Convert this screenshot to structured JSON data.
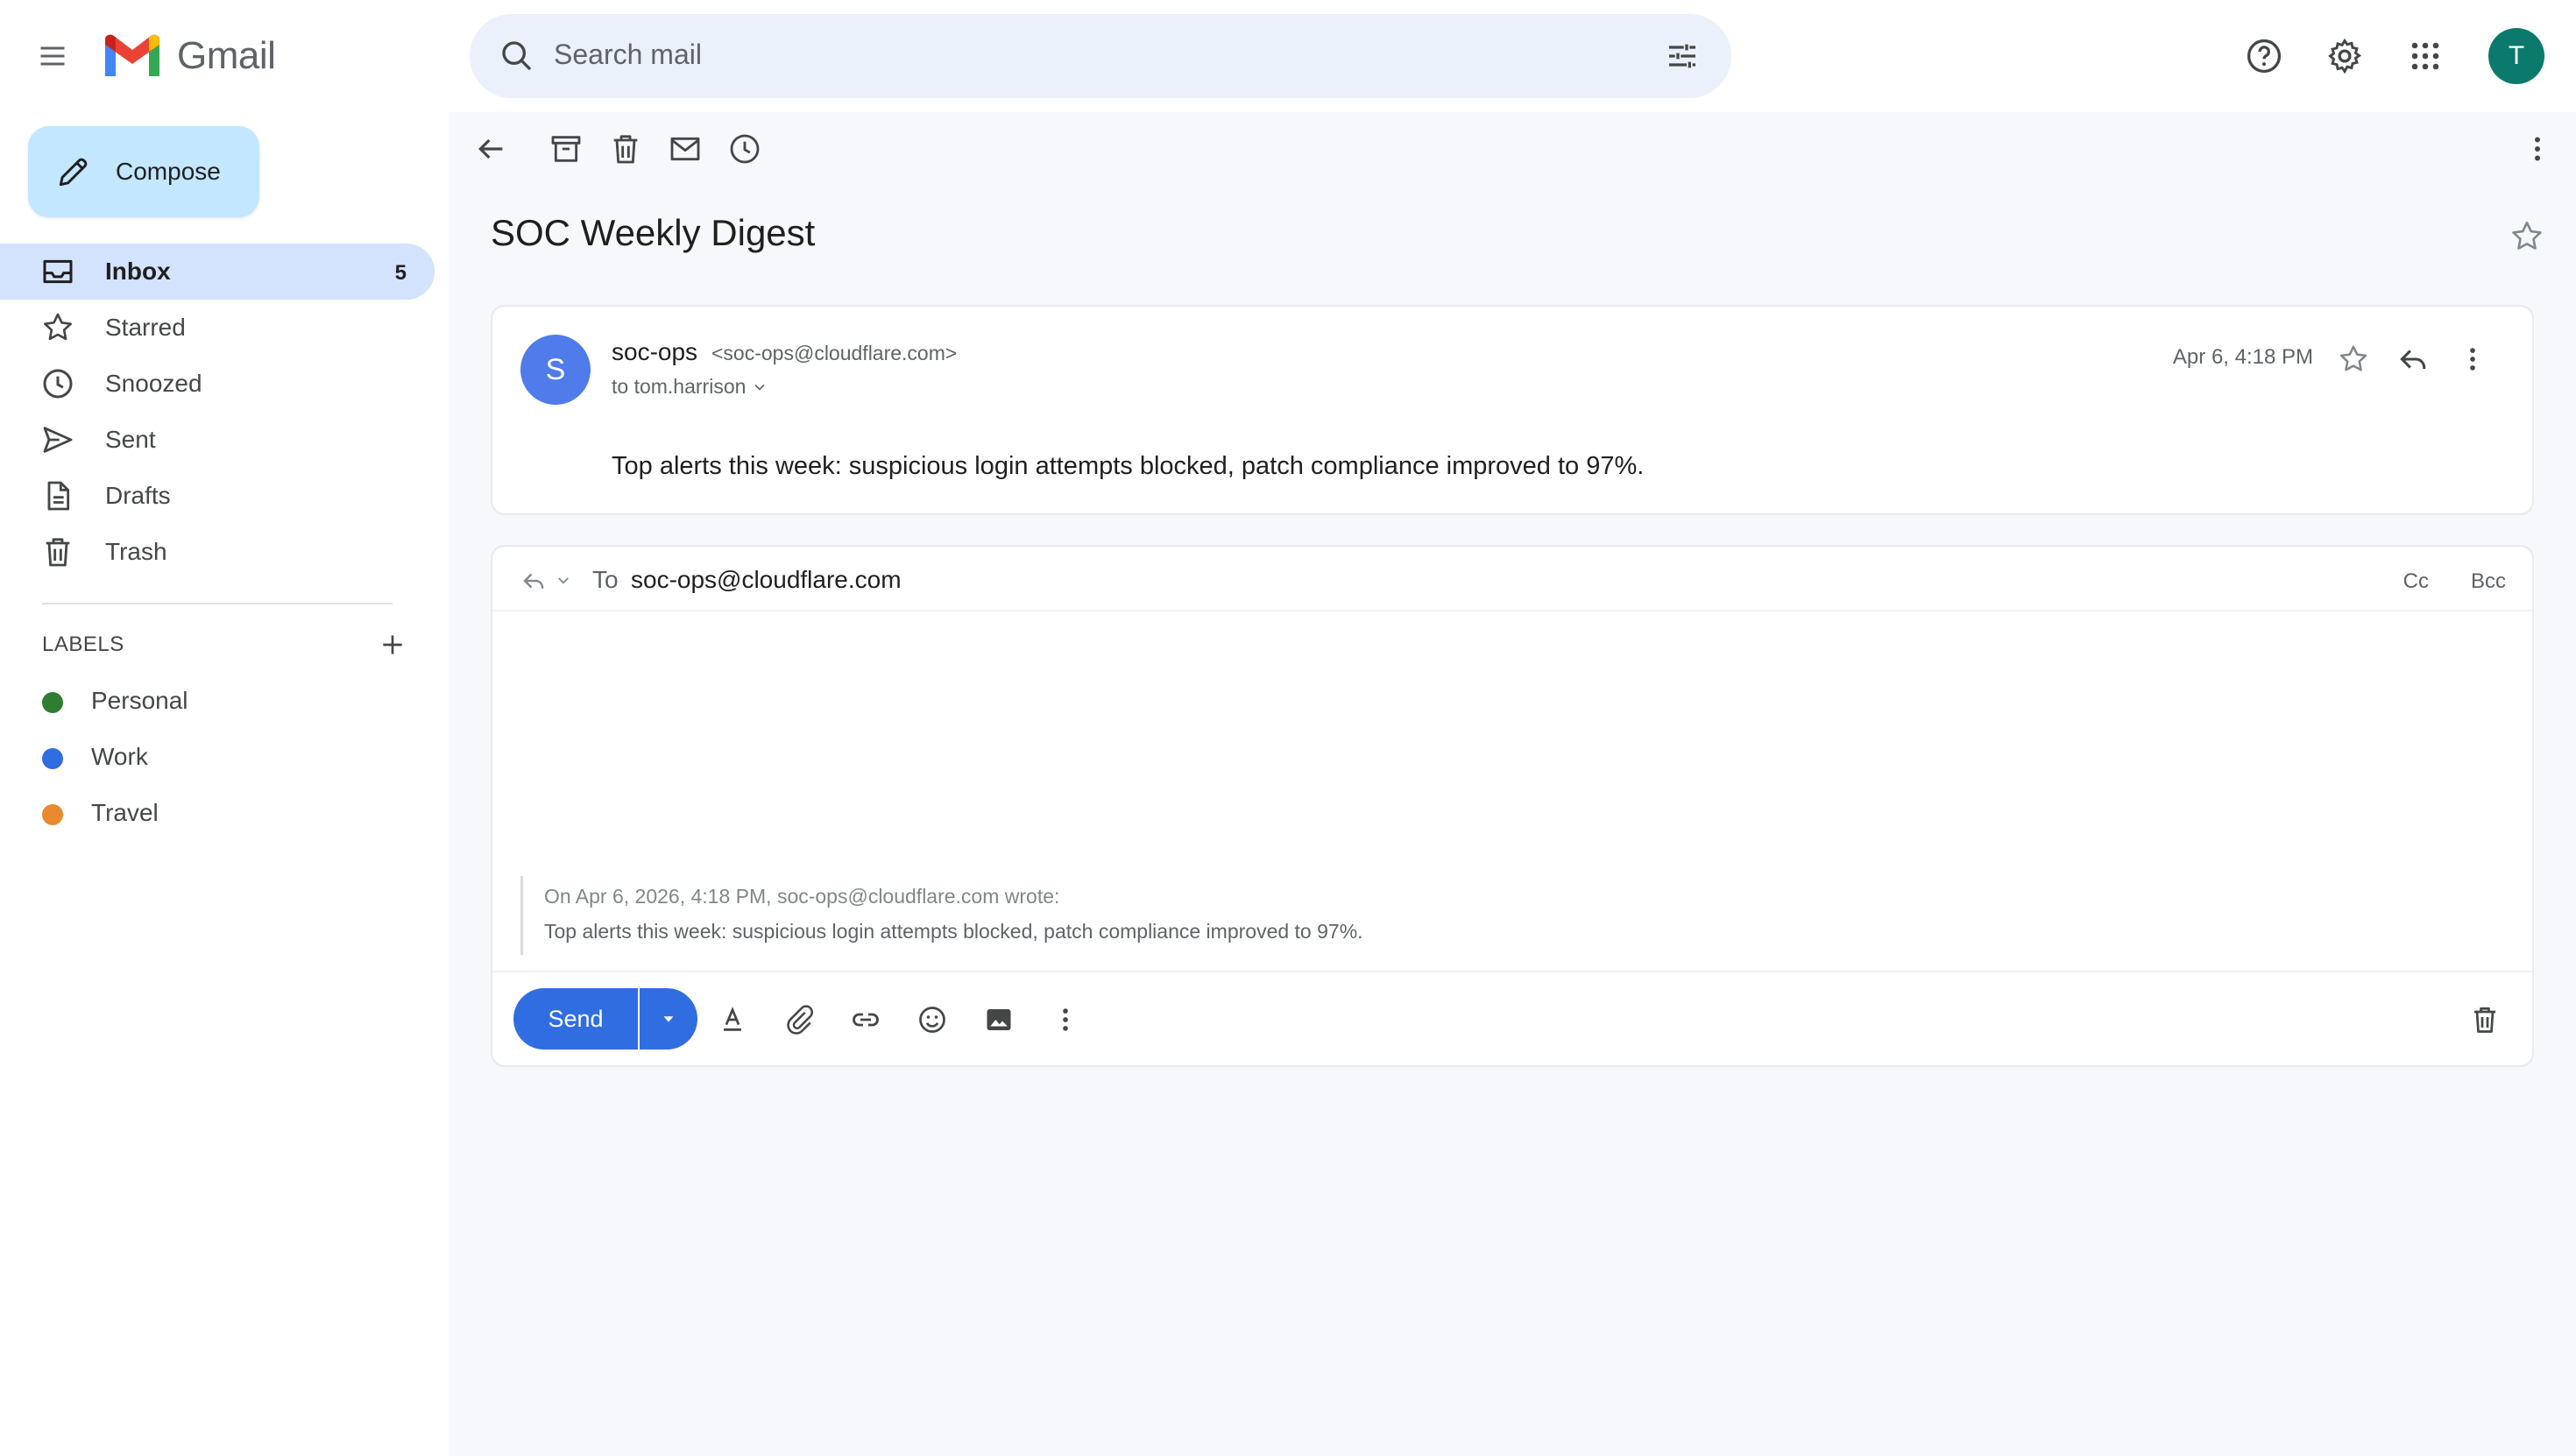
{
  "app": {
    "name": "Gmail",
    "avatar_initial": "T",
    "colors": {
      "accent": "#2f6de1",
      "compose_bg": "#c2e7ff",
      "active_nav": "#d3e3fd",
      "avatar": "#0b7a6d",
      "sender_avatar": "#4f7cea"
    }
  },
  "search": {
    "placeholder": "Search mail"
  },
  "sidebar": {
    "compose_label": "Compose",
    "items": [
      {
        "label": "Inbox",
        "icon": "inbox-icon",
        "count": "5",
        "active": true
      },
      {
        "label": "Starred",
        "icon": "star-icon"
      },
      {
        "label": "Snoozed",
        "icon": "clock-icon"
      },
      {
        "label": "Sent",
        "icon": "send-icon"
      },
      {
        "label": "Drafts",
        "icon": "draft-icon"
      },
      {
        "label": "Trash",
        "icon": "trash-icon"
      }
    ],
    "labels_header": "LABELS",
    "labels": [
      {
        "name": "Personal",
        "color": "#2e7d32"
      },
      {
        "name": "Work",
        "color": "#2f6de1"
      },
      {
        "name": "Travel",
        "color": "#e8892d"
      }
    ]
  },
  "message": {
    "subject": "SOC Weekly Digest",
    "sender_initial": "S",
    "sender_name": "soc-ops",
    "sender_email": "<soc-ops@cloudflare.com>",
    "recipient": "to tom.harrison",
    "date": "Apr 6, 4:18 PM",
    "body": "Top alerts this week: suspicious login attempts blocked, patch compliance improved to 97%."
  },
  "reply": {
    "to_label": "To",
    "to_value": "soc-ops@cloudflare.com",
    "cc": "Cc",
    "bcc": "Bcc",
    "quote_attribution": "On Apr 6, 2026, 4:18 PM, soc-ops@cloudflare.com wrote:",
    "quote_text": "Top alerts this week: suspicious login attempts blocked, patch compliance improved to 97%.",
    "send_label": "Send"
  }
}
